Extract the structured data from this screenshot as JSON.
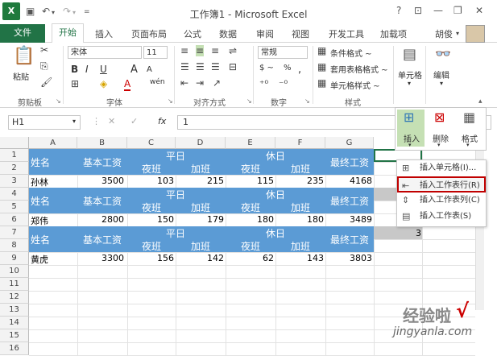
{
  "titlebar": {
    "title": "工作簿1 - Microsoft Excel",
    "help": "?",
    "account": "胡俊"
  },
  "tabs": [
    "文件",
    "开始",
    "插入",
    "页面布局",
    "公式",
    "数据",
    "审阅",
    "视图",
    "开发工具",
    "加载项"
  ],
  "ribbon": {
    "clipboard": {
      "paste": "粘贴",
      "label": "剪贴板"
    },
    "font": {
      "name": "宋体",
      "size": "11",
      "bold": "B",
      "italic": "I",
      "underline": "U",
      "grow": "A",
      "shrink": "A",
      "label": "字体",
      "color_letter": "A",
      "wen": "wén"
    },
    "alignment": {
      "label": "对齐方式"
    },
    "number": {
      "format": "常规",
      "currency": "$ ~",
      "percent": "%",
      "comma": ",",
      "label": "数字"
    },
    "styles": {
      "conditional": "条件格式 ~",
      "table": "套用表格格式 ~",
      "cell": "单元格样式 ~",
      "label": "样式"
    },
    "cells": {
      "label": "单元格"
    },
    "editing": {
      "label": "编辑"
    }
  },
  "cells_dropdown": {
    "insert": "插入",
    "delete": "删除",
    "format": "格式"
  },
  "menu": [
    {
      "label": "插入单元格(I)...",
      "icon": "insert-cells-icon"
    },
    {
      "label": "插入工作表行(R)",
      "icon": "insert-rows-icon"
    },
    {
      "label": "插入工作表列(C)",
      "icon": "insert-columns-icon"
    },
    {
      "label": "插入工作表(S)",
      "icon": "insert-sheet-icon"
    }
  ],
  "formula_bar": {
    "name_box": "H1",
    "fx": "fx",
    "value": "1"
  },
  "columns": [
    "A",
    "B",
    "C",
    "D",
    "E",
    "F",
    "G"
  ],
  "rows": [
    "1",
    "2",
    "3",
    "4",
    "5",
    "6",
    "7",
    "8",
    "9",
    "10",
    "11",
    "12",
    "13",
    "14",
    "15",
    "16"
  ],
  "table": {
    "header_name": "姓名",
    "header_base": "基本工资",
    "header_weekday": "平日",
    "header_holiday": "休日",
    "header_final": "最终工资",
    "sub_night": "夜班",
    "sub_overtime": "加班",
    "records": [
      {
        "name": "孙林",
        "base": "3500",
        "wn": "103",
        "wo": "215",
        "hn": "115",
        "ho": "235",
        "final": "4168"
      },
      {
        "name": "郑伟",
        "base": "2800",
        "wn": "150",
        "wo": "179",
        "hn": "180",
        "ho": "180",
        "final": "3489"
      },
      {
        "name": "黄虎",
        "base": "3300",
        "wn": "156",
        "wo": "142",
        "hn": "62",
        "ho": "143",
        "final": "3803"
      }
    ]
  },
  "h_values": {
    "h7": "3"
  },
  "watermark": {
    "text": "经验啦",
    "check": "√",
    "url": "jingyanla.com"
  }
}
